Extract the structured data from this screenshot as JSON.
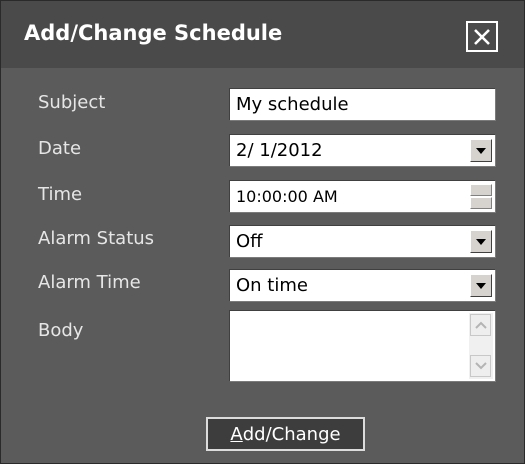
{
  "dialog": {
    "title": "Add/Change Schedule",
    "close_icon": "close-icon"
  },
  "form": {
    "subject": {
      "label": "Subject",
      "value": "My schedule"
    },
    "date": {
      "label": "Date",
      "value": "2/ 1/2012"
    },
    "time": {
      "label": "Time",
      "value": "10:00:00 AM"
    },
    "alarm_status": {
      "label": "Alarm Status",
      "value": "Off"
    },
    "alarm_time": {
      "label": "Alarm Time",
      "value": "On time"
    },
    "body": {
      "label": "Body",
      "value": ""
    }
  },
  "actions": {
    "submit_mnemonic": "A",
    "submit_rest": "dd/Change"
  },
  "colors": {
    "background": "#5b5b5b",
    "titlebar": "#4a4a4a",
    "label_text": "#e6e6e6",
    "button_bg": "#3d3d3d"
  }
}
